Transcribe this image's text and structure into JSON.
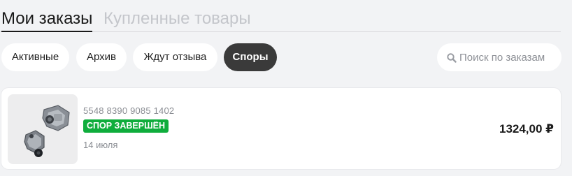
{
  "tabs": {
    "active_label": "Мои заказы",
    "inactive_label": "Купленные товары"
  },
  "filters": [
    {
      "label": "Активные",
      "selected": false
    },
    {
      "label": "Архив",
      "selected": false
    },
    {
      "label": "Ждут отзыва",
      "selected": false
    },
    {
      "label": "Споры",
      "selected": true
    }
  ],
  "search": {
    "icon": "search-icon",
    "placeholder": "Поиск по заказам",
    "value": ""
  },
  "orders": [
    {
      "number": "5548 8390 9085 1402",
      "status": "СПОР ЗАВЕРШЁН",
      "status_color": "#0fad3c",
      "date": "14 июля",
      "price": "1324,00 ₽"
    }
  ],
  "colors": {
    "background": "#f2f3f5",
    "chip_selected": "#3a3a3a",
    "muted_text": "#8a8d93"
  }
}
